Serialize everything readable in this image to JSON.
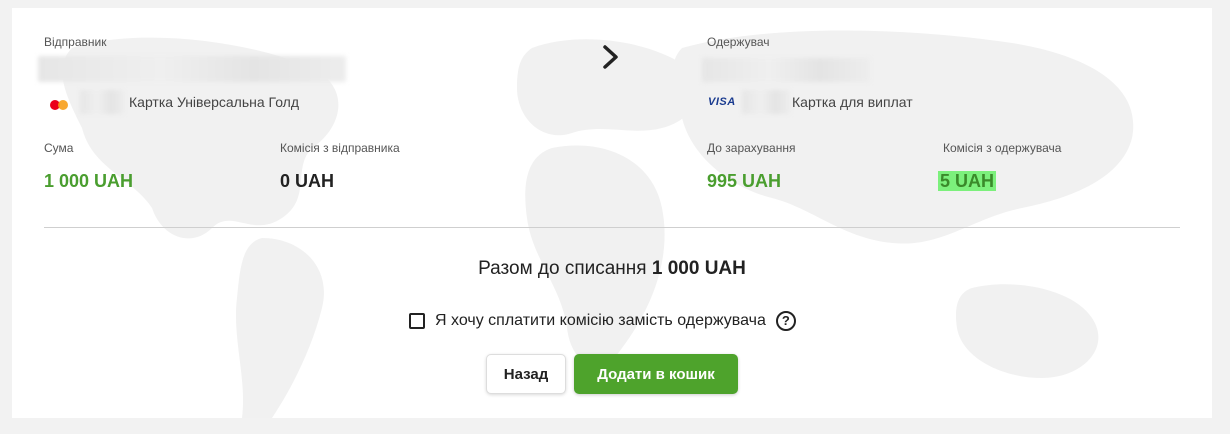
{
  "sender": {
    "label": "Відправник",
    "card_name": "Картка Універсальна Голд",
    "card_icon": "mastercard-icon"
  },
  "recipient": {
    "label": "Одержувач",
    "card_name": "Картка для виплат",
    "card_icon": "visa-icon",
    "card_brand_text": "VISA"
  },
  "amounts": {
    "sum_label": "Сума",
    "sum_value": "1 000 UAH",
    "sender_fee_label": "Комісія з відправника",
    "sender_fee_value": "0 UAH",
    "credit_label": "До зарахування",
    "credit_value": "995 UAH",
    "recipient_fee_label": "Комісія з одержувача",
    "recipient_fee_value": "5 UAH"
  },
  "total": {
    "label": "Разом до списання",
    "value": "1 000 UAH"
  },
  "pay_fee_checkbox": {
    "label": "Я хочу сплатити комісію замість одержувача",
    "checked": false,
    "help_symbol": "?"
  },
  "buttons": {
    "back": "Назад",
    "add_to_cart": "Додати в кошик"
  },
  "colors": {
    "accent_green": "#4ea32c",
    "amount_green": "#4a9e2f",
    "highlight": "#7cf07c"
  }
}
